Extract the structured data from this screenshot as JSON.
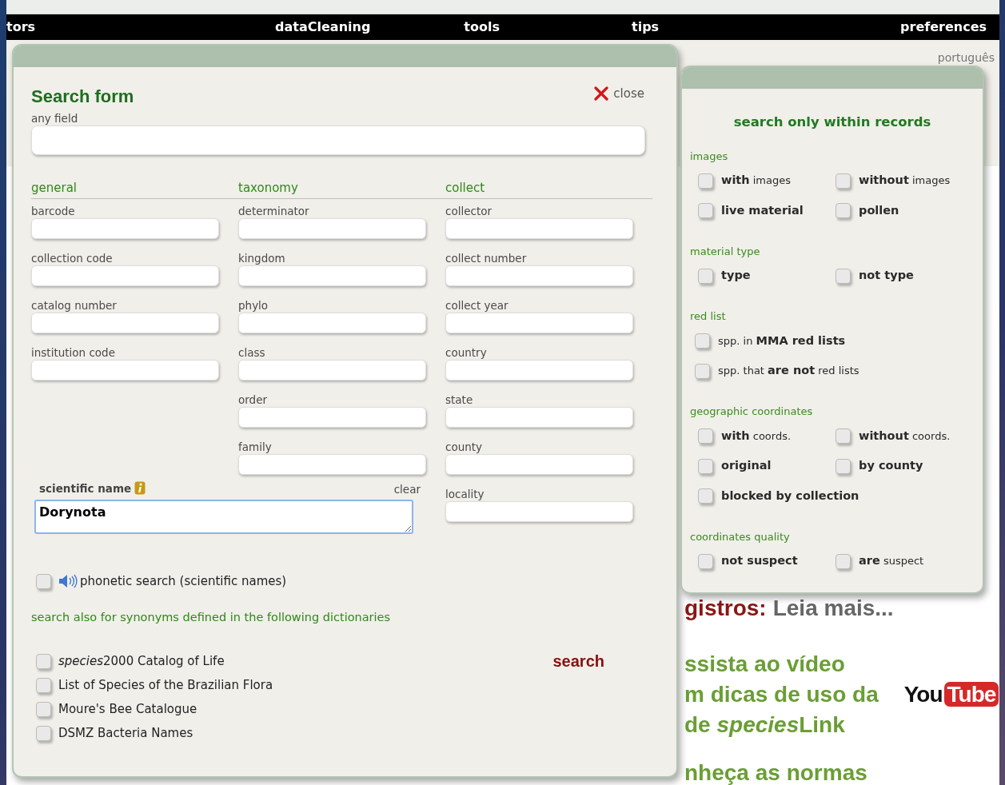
{
  "topnav": [
    {
      "label": "tors"
    },
    {
      "label": "dataCleaning"
    },
    {
      "label": "tools"
    },
    {
      "label": "tips"
    },
    {
      "label": "preferences"
    }
  ],
  "language": "português",
  "background": {
    "notice_red": "gistros:",
    "notice_more": "Leia mais...",
    "video_lines": [
      {
        "text": "ssista ao vídeo"
      },
      {
        "text": "m dicas de uso da"
      },
      {
        "text": "de ",
        "italic_part": "species",
        "rest": "Link"
      }
    ],
    "rules_line": "nheça as normas",
    "logo": {
      "text_dark": "You",
      "text_on_red": "Tube"
    }
  },
  "search_form": {
    "title": "Search form",
    "close_label": "close",
    "any_field": {
      "label": "any field"
    },
    "columns": [
      {
        "heading": "general",
        "fields": [
          {
            "label": "barcode"
          },
          {
            "label": "collection code"
          },
          {
            "label": "catalog number"
          },
          {
            "label": "institution code"
          }
        ]
      },
      {
        "heading": "taxonomy",
        "fields": [
          {
            "label": "determinator"
          },
          {
            "label": "kingdom"
          },
          {
            "label": "phylo"
          },
          {
            "label": "class"
          },
          {
            "label": "order"
          },
          {
            "label": "family"
          }
        ]
      },
      {
        "heading": "collect",
        "fields": [
          {
            "label": "collector"
          },
          {
            "label": "collect number"
          },
          {
            "label": "collect year"
          },
          {
            "label": "country"
          },
          {
            "label": "state"
          },
          {
            "label": "county"
          },
          {
            "label": "locality"
          }
        ]
      }
    ],
    "scientific_name": {
      "label": "scientific name",
      "clear_label": "clear",
      "value": "Dorynota"
    },
    "phonetic": {
      "label": "phonetic search (scientific names)",
      "checked": false
    },
    "synonyms": {
      "heading": "search also for synonyms defined in the following dictionaries",
      "dictionaries": [
        {
          "italic_part": "species",
          "label": "2000 Catalog of Life",
          "checked": false
        },
        {
          "label": "List of Species of the Brazilian Flora",
          "checked": false
        },
        {
          "label": "Moure's Bee Catalogue",
          "checked": false
        },
        {
          "label": "DSMZ Bacteria Names",
          "checked": false
        }
      ]
    },
    "search_button": "search"
  },
  "filters": {
    "title": "search only within records",
    "sections": [
      {
        "heading": "images",
        "kind": "grid",
        "options": [
          {
            "label": "**with** images",
            "checked": false
          },
          {
            "label": "**without** images",
            "checked": false
          },
          {
            "label": "**live material**",
            "checked": false
          },
          {
            "label": "**pollen**",
            "checked": false
          }
        ]
      },
      {
        "heading": "material type",
        "kind": "grid",
        "options": [
          {
            "label": "**type**",
            "checked": false
          },
          {
            "label": "**not type**",
            "checked": false
          }
        ]
      },
      {
        "heading": "red list",
        "kind": "list",
        "options": [
          {
            "label": "spp. in **MMA red lists**",
            "checked": false
          },
          {
            "label": "spp. that **are not** red lists",
            "checked": false
          }
        ]
      },
      {
        "heading": "geographic coordinates",
        "kind": "grid",
        "options": [
          {
            "label": "**with** coords.",
            "checked": false
          },
          {
            "label": "**without** coords.",
            "checked": false
          },
          {
            "label": "**original**",
            "checked": false
          },
          {
            "label": "**by county**",
            "checked": false
          },
          {
            "label": "**blocked by collection**",
            "checked": false
          }
        ]
      },
      {
        "heading": "coordinates quality",
        "kind": "grid",
        "options": [
          {
            "label": "**not suspect**",
            "checked": false
          },
          {
            "label": "**are** suspect",
            "checked": false
          }
        ]
      }
    ]
  }
}
